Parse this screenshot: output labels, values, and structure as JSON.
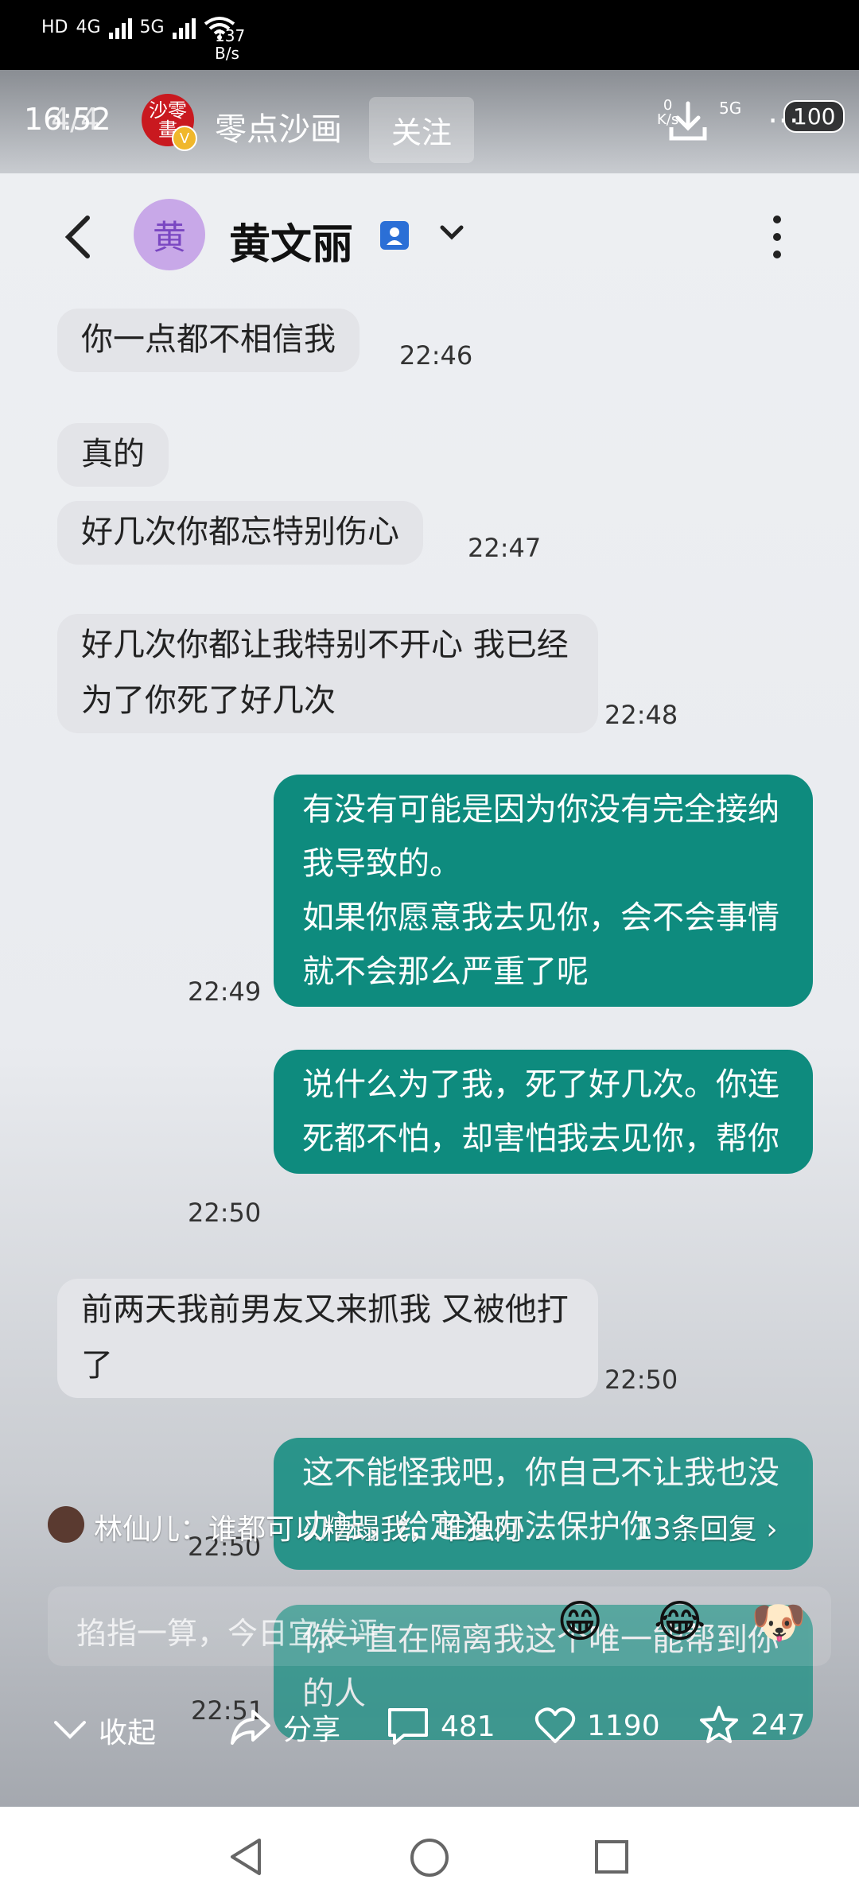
{
  "status_bar": {
    "network_labels": [
      "HD",
      "4G",
      "5G"
    ],
    "speed_value": "137",
    "speed_unit": "B/s"
  },
  "top_bar": {
    "time": "16:52",
    "page_counter": "4/4",
    "author_logo_text": "沙零\n畫",
    "author_name": "零点沙画",
    "follow_label": "关注",
    "battery": "100",
    "net_speed": "0\nK/s",
    "right_network": "5G"
  },
  "chat": {
    "contact_initial": "黄",
    "contact_name": "黄文丽",
    "messages": [
      {
        "side": "in",
        "text": "你一点都不相信我",
        "time": "22:46"
      },
      {
        "side": "in",
        "text": "真的",
        "time": ""
      },
      {
        "side": "in",
        "text": "好几次你都忘特别伤心",
        "time": "22:47"
      },
      {
        "side": "in",
        "text": "好几次你都让我特别不开心 我已经为了你死了好几次",
        "time": "22:48"
      },
      {
        "side": "out",
        "text": "有没有可能是因为你没有完全接纳我导致的。\n如果你愿意我去见你，会不会事情就不会那么严重了呢",
        "time": "22:49"
      },
      {
        "side": "out",
        "text": "说什么为了我，死了好几次。你连死都不怕，却害怕我去见你，帮你",
        "time": "22:50"
      },
      {
        "side": "in",
        "text": "前两天我前男友又来抓我 又被他打了",
        "time": "22:50"
      },
      {
        "side": "out",
        "text": "这不能怪我吧，你自己不让我也没办法，给定没办法保护你",
        "time": "22:50"
      },
      {
        "side": "out",
        "text": "你一直在隔离我这个唯一能帮到你的人",
        "time": "22:51"
      }
    ]
  },
  "comment_preview": {
    "user": "林仙儿",
    "text": "：谁都可以糟蹋我，唯独阿…",
    "replies": "13条回复"
  },
  "comment_input": {
    "placeholder": "掐指一算，今日宜发评",
    "emojis": [
      "😁",
      "😂",
      "🐶"
    ]
  },
  "actions": {
    "collapse": "收起",
    "share": "分享",
    "comments": "481",
    "likes": "1190",
    "favorites": "247"
  },
  "icons": {
    "back": "back-arrow-icon",
    "more": "more-vertical-icon",
    "download": "download-icon",
    "share": "share-icon",
    "comment": "comment-icon",
    "like": "heart-icon",
    "favorite": "star-icon"
  }
}
